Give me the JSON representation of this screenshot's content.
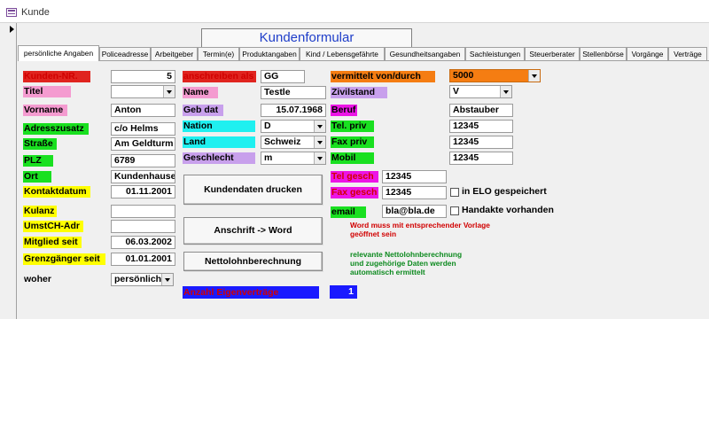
{
  "window": {
    "title": "Kunde"
  },
  "form": {
    "title": "Kundenformular"
  },
  "tabs": [
    "persönliche Angaben",
    "Policeadresse",
    "Arbeitgeber",
    "Termin(e)",
    "Produktangaben",
    "Kind / Lebensgefährte",
    "Gesundheitsangaben",
    "Sachleistungen",
    "Steuerberater",
    "Stellenbörse",
    "Vorgänge",
    "Verträge"
  ],
  "colors": {
    "label_red": "#e0241f",
    "label_pink": "#f49bd0",
    "label_green": "#19e020",
    "label_yellow": "#ffff00",
    "label_lavender": "#c8a0ec",
    "label_cyan": "#1ff0f0",
    "label_orange": "#f57d12",
    "label_magenta": "#ec14e6",
    "label_blue": "#1a1aff",
    "text_blue": "#1f3ec9",
    "text_red": "#d10000",
    "text_green": "#0d8a1f"
  },
  "left": {
    "kunden_nr": {
      "label": "Kunden-NR.",
      "value": "5"
    },
    "titel": {
      "label": "Titel",
      "value": ""
    },
    "vorname": {
      "label": "Vorname",
      "value": "Anton"
    },
    "adresszusatz": {
      "label": "Adresszusatz",
      "value": "c/o Helms"
    },
    "strasse": {
      "label": "Straße",
      "value": "Am Geldturm"
    },
    "plz": {
      "label": "PLZ",
      "value": "6789"
    },
    "ort": {
      "label": "Ort",
      "value": "Kundenhause"
    },
    "kontaktdatum": {
      "label": "Kontaktdatum",
      "value": "01.11.2001"
    },
    "kulanz": {
      "label": "Kulanz",
      "value": ""
    },
    "umstch": {
      "label": "UmstCH-Adr",
      "value": ""
    },
    "mitglied": {
      "label": "Mitglied seit",
      "value": "06.03.2002"
    },
    "grenzgaenger": {
      "label": "Grenzgänger seit",
      "value": "01.01.2001"
    },
    "woher": {
      "label": "woher",
      "value": "persönlich"
    }
  },
  "middle": {
    "anschreiben": {
      "label": "anschreiben als",
      "value": "GG"
    },
    "name": {
      "label": "Name",
      "value": "Testle"
    },
    "geb_dat": {
      "label": "Geb dat",
      "value": "15.07.1968"
    },
    "nation": {
      "label": "Nation",
      "value": "D"
    },
    "land": {
      "label": "Land",
      "value": "Schweiz"
    },
    "geschlecht": {
      "label": "Geschlecht",
      "value": "m"
    },
    "btn_drucken": "Kundendaten  drucken",
    "btn_word": "Anschrift -> Word",
    "btn_netto": "Nettolohnberechnung",
    "eigenvertraege": {
      "label": "Anzahl Eigenverträge",
      "value": "1"
    }
  },
  "right": {
    "vermittelt": {
      "label": "vermittelt von/durch",
      "value": "5000"
    },
    "zivilstand": {
      "label": "Zivilstand",
      "value": "V"
    },
    "beruf": {
      "label": "Beruf",
      "value": "Abstauber"
    },
    "tel_priv": {
      "label": "Tel. priv",
      "value": "12345"
    },
    "fax_priv": {
      "label": "Fax priv",
      "value": "12345"
    },
    "mobil": {
      "label": "Mobil",
      "value": "12345"
    },
    "tel_gesch": {
      "label": "Tel gesch",
      "value": "12345"
    },
    "fax_gesch": {
      "label": "Fax gesch",
      "value": "12345"
    },
    "email": {
      "label": "email",
      "value": "bla@bla.de"
    },
    "elo_label": "in ELO gespeichert",
    "handakte_label": "Handakte vorhanden",
    "word_note": [
      "Word muss mit entsprechender Vorlage",
      "geöffnet sein"
    ],
    "netto_note": [
      "relevante Nettolohnberechnung",
      "und zugehörige Daten werden",
      "automatisch ermittelt"
    ]
  }
}
